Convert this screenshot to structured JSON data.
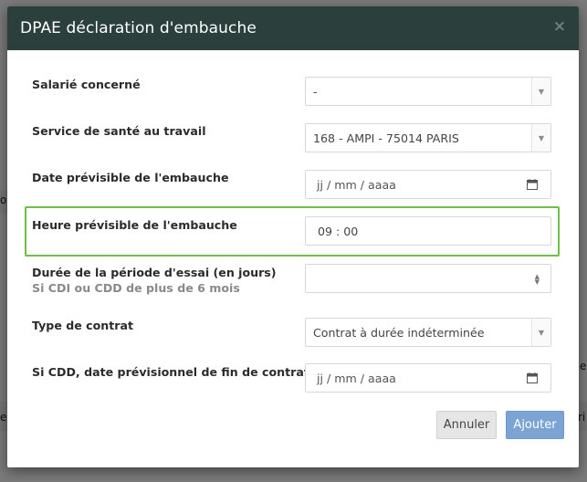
{
  "background": {
    "fragments": [
      "o",
      "e",
      "e",
      "ri"
    ]
  },
  "modal": {
    "title": "DPAE déclaration d'embauche",
    "close_glyph": "×",
    "fields": [
      {
        "label": "Salarié concerné",
        "type": "select",
        "value": "-"
      },
      {
        "label": "Service de santé au travail",
        "type": "select",
        "value": "168 - AMPI - 75014 PARIS"
      },
      {
        "label": "Date prévisible de l'embauche",
        "type": "date",
        "value": "jj / mm / aaaa"
      },
      {
        "label": "Heure prévisible de l'embauche",
        "type": "time",
        "value": "09 : 00"
      },
      {
        "label": "Durée de la période d'essai (en jours)",
        "sublabel": "Si CDI ou CDD de plus de 6 mois",
        "type": "number",
        "value": ""
      },
      {
        "label": "Type de contrat",
        "type": "select",
        "value": "Contrat à durée indéterminée"
      },
      {
        "label": "Si CDD, date prévisionnel de fin de contrat",
        "type": "date",
        "value": "jj / mm / aaaa"
      }
    ],
    "buttons": {
      "cancel_label": "Annuler",
      "submit_label": "Ajouter"
    }
  },
  "colors": {
    "header_bg": "#2b403c",
    "highlight": "#6cc04a",
    "submit_bg": "#7ba3d4"
  }
}
